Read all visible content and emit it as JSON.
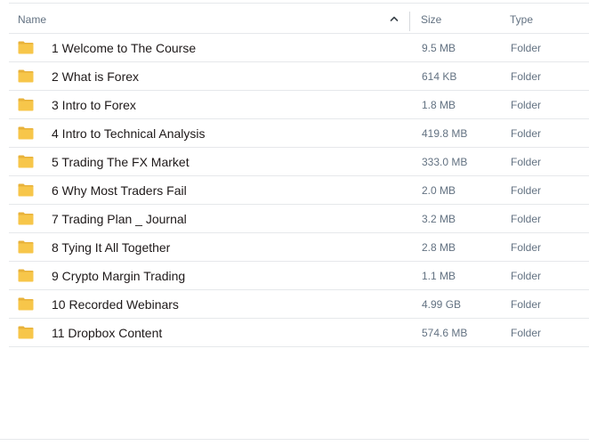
{
  "header": {
    "name_label": "Name",
    "size_label": "Size",
    "type_label": "Type",
    "sort": "name-ascending"
  },
  "colors": {
    "folder": "#f7c64a",
    "folder_dark": "#e8b23a",
    "secondary_text": "#637282",
    "primary_text": "#1e1919",
    "rule": "#e6e8eb"
  },
  "rows": [
    {
      "name": "1 Welcome to The Course",
      "size": "9.5 MB",
      "type": "Folder",
      "icon": "folder-icon"
    },
    {
      "name": "2 What is Forex",
      "size": "614 KB",
      "type": "Folder",
      "icon": "folder-icon"
    },
    {
      "name": "3 Intro to Forex",
      "size": "1.8 MB",
      "type": "Folder",
      "icon": "folder-icon"
    },
    {
      "name": "4 Intro to Technical Analysis",
      "size": "419.8 MB",
      "type": "Folder",
      "icon": "folder-icon"
    },
    {
      "name": "5 Trading The FX Market",
      "size": "333.0 MB",
      "type": "Folder",
      "icon": "folder-icon"
    },
    {
      "name": "6 Why Most Traders Fail",
      "size": "2.0 MB",
      "type": "Folder",
      "icon": "folder-icon"
    },
    {
      "name": "7 Trading Plan _ Journal",
      "size": "3.2 MB",
      "type": "Folder",
      "icon": "folder-icon"
    },
    {
      "name": "8 Tying It All Together",
      "size": "2.8 MB",
      "type": "Folder",
      "icon": "folder-icon"
    },
    {
      "name": "9 Crypto Margin Trading",
      "size": "1.1 MB",
      "type": "Folder",
      "icon": "folder-icon"
    },
    {
      "name": "10 Recorded Webinars",
      "size": "4.99 GB",
      "type": "Folder",
      "icon": "folder-icon"
    },
    {
      "name": "11 Dropbox Content",
      "size": "574.6 MB",
      "type": "Folder",
      "icon": "folder-icon"
    }
  ]
}
